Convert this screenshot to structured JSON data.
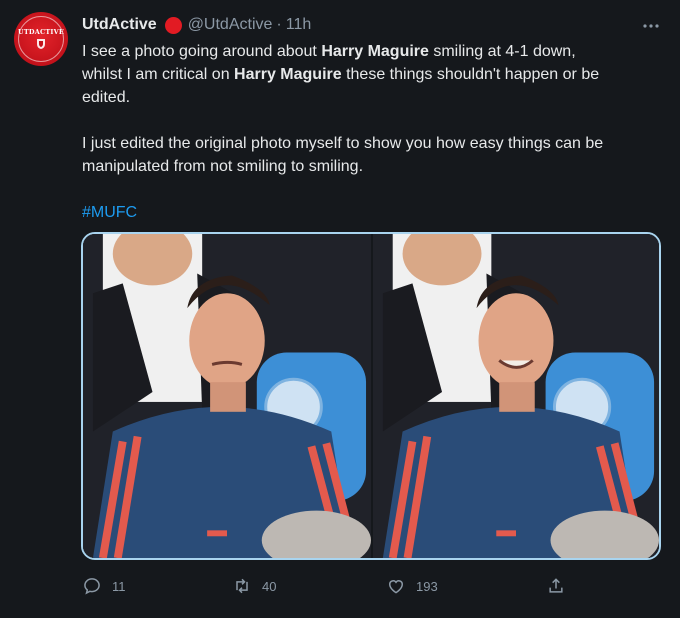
{
  "account": {
    "display_name": "UtdActive",
    "handle": "@UtdActive",
    "separator": "·",
    "time": "11h",
    "avatar_text": "UTDACTIVE",
    "verified_color": "#e21b23"
  },
  "tweet": {
    "line1_a": "I see a photo going around about ",
    "line1_bold": "Harry Maguire",
    "line1_b": " smiling at 4-1 down,",
    "line2_a": "whilst I am critical on ",
    "line2_bold": "Harry Maguire",
    "line2_b": " these things shouldn't happen or be",
    "line3": "edited.",
    "para2_line1": "I just edited the original photo myself to show you how easy things can be",
    "para2_line2": "manipulated from not smiling to smiling.",
    "hashtag": "#MUFC"
  },
  "media": {
    "images": [
      {
        "name": "original-photo",
        "smiling": false
      },
      {
        "name": "edited-photo",
        "smiling": true
      }
    ]
  },
  "actions": {
    "reply_count": "11",
    "retweet_count": "40",
    "like_count": "193"
  },
  "icons": [
    "verified-badge-icon",
    "more-options-icon",
    "reply-icon",
    "retweet-icon",
    "like-icon",
    "share-icon"
  ],
  "colors": {
    "background": "#15181c",
    "text": "#e7e9ea",
    "muted": "#8b98a5",
    "link": "#1d9bf0",
    "brand_red": "#c4121b"
  }
}
